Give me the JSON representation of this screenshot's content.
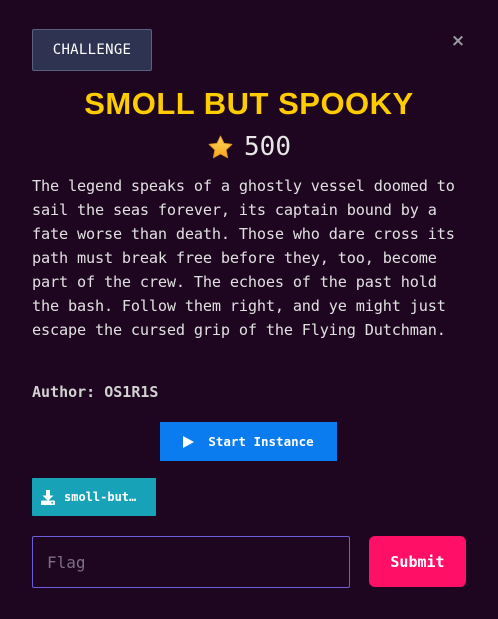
{
  "modal": {
    "tab_label": "CHALLENGE",
    "close_icon": "×",
    "title": "SMOLL BUT SPOOKY",
    "points": "500",
    "description": "The legend speaks of a ghostly vessel doomed to sail the seas forever, its captain bound by a fate worse than death. Those who dare cross its path must break free before they, too, become part of the crew. The echoes of the past hold the bash. Follow them right, and ye might just escape the cursed grip of the Flying Dutchman.",
    "author": "Author: OS1R1S",
    "start_instance_label": "Start Instance",
    "file_label": "smoll-but…",
    "flag_placeholder": "Flag",
    "flag_value": "",
    "submit_label": "Submit"
  },
  "icons": {
    "star": "star-icon",
    "play": "play-icon",
    "download": "download-icon",
    "close": "close-icon"
  },
  "colors": {
    "background": "#1e0620",
    "title": "#ffcc00",
    "start_button": "#0b7bf0",
    "file_button": "#17a2b8",
    "submit_button": "#ff0f66",
    "input_border": "#6a5fd8"
  }
}
